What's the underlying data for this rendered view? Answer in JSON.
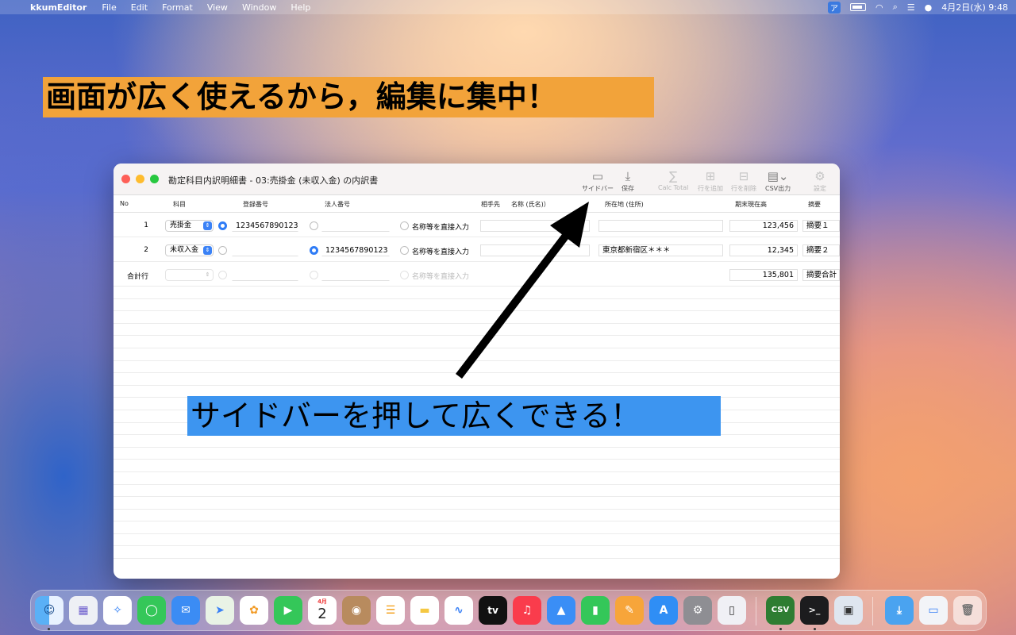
{
  "menubar": {
    "app_name": "kkumEditor",
    "items": [
      "File",
      "Edit",
      "Format",
      "View",
      "Window",
      "Help"
    ],
    "ime": "ア",
    "clock": "4月2日(水) 9:48"
  },
  "captions": {
    "top": "画面が広く使えるから，編集に集中！",
    "bottom": "サイドバーを押して広くできる！"
  },
  "window": {
    "title": "勘定科目内訳明細書 - 03:売掛金 (未収入金) の内訳書",
    "toolbar": {
      "sidebar": "サイドバー",
      "save": "保存",
      "calc_total": "Calc Total",
      "add_row": "行を追加",
      "delete_row": "行を削除",
      "csv_export": "CSV出力",
      "settings": "設定"
    },
    "columns": {
      "no": "No",
      "account": "科目",
      "reg_no": "登録番号",
      "corp_no": "法人番号",
      "partner": "相手先",
      "name": "名称 (氏名)）",
      "address": "所在地 (住所)",
      "balance": "期末現在高",
      "summary": "摘要"
    },
    "rows": [
      {
        "no": "1",
        "account": "売掛金",
        "reg_no": "1234567890123",
        "corp_no": "",
        "direct_input": "名称等を直接入力",
        "name": "",
        "address": "",
        "balance": "123,456",
        "summary": "摘要１"
      },
      {
        "no": "2",
        "account": "未収入金",
        "reg_no": "",
        "corp_no": "1234567890123",
        "direct_input": "名称等を直接入力",
        "name": "",
        "address": "東京都新宿区＊＊＊",
        "balance": "12,345",
        "summary": "摘要２"
      },
      {
        "no": "合計行",
        "account": "",
        "reg_no": "",
        "corp_no": "",
        "direct_input": "名称等を直接入力",
        "name": "",
        "address": "",
        "balance": "135,801",
        "summary": "摘要合計"
      }
    ]
  },
  "dock": {
    "calendar_month": "4月",
    "calendar_day": "2",
    "tv_label": "tv",
    "etax_label": "CSV"
  }
}
